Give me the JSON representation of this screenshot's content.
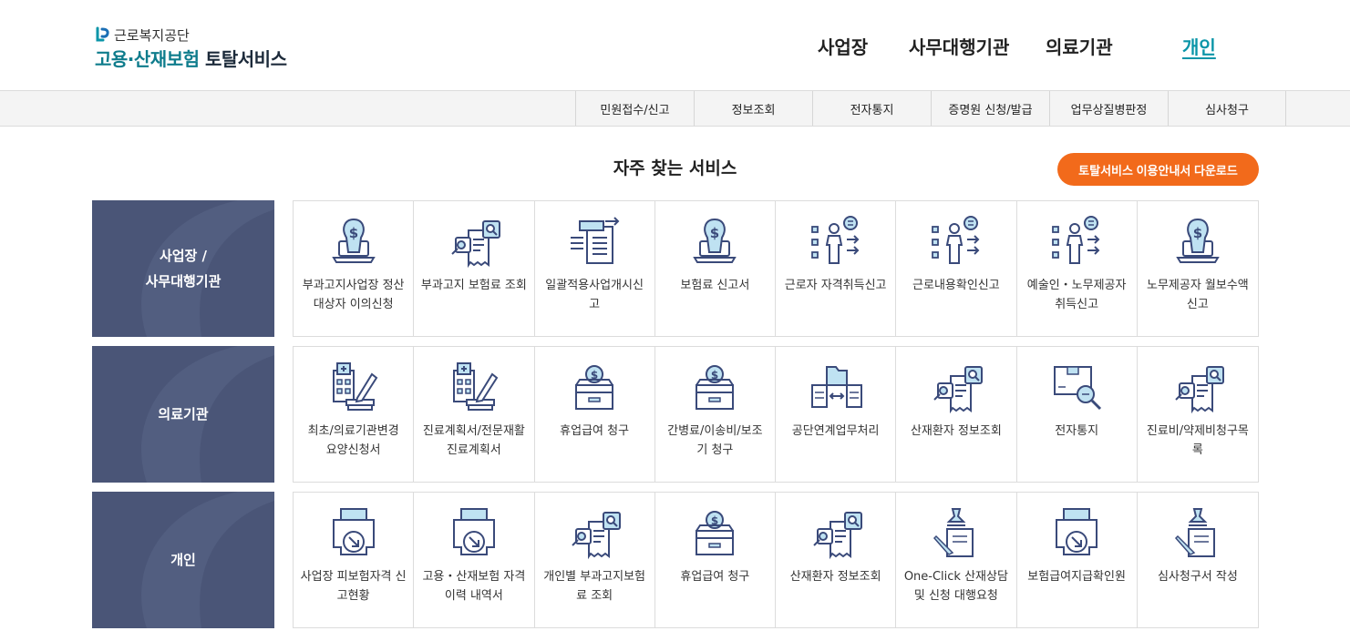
{
  "header": {
    "logo_top": "근로복지공단",
    "logo_bottom_teal": "고용·산재보험",
    "logo_bottom_dark": "토탈서비스",
    "nav": [
      {
        "label": "사업장",
        "active": false
      },
      {
        "label": "사무대행기관",
        "active": false
      },
      {
        "label": "의료기관",
        "active": false
      },
      {
        "label": "개인",
        "active": true
      }
    ]
  },
  "subnav": [
    "민원접수/신고",
    "정보조회",
    "전자통지",
    "증명원 신청/발급",
    "업무상질병판정",
    "심사청구"
  ],
  "section": {
    "title": "자주 찾는 서비스",
    "download_label": "토탈서비스 이용안내서 다운로드"
  },
  "colors": {
    "teal": "#0a95a8",
    "navy": "#3a4a7a",
    "orange": "#f26a1b",
    "label_bg": "#4a5577"
  },
  "rows": [
    {
      "label": "사업장 /\n사무대행기관",
      "items": [
        {
          "label": "부과고지사업장 정산대상자 이의신청",
          "icon": "laptop-coin-icon"
        },
        {
          "label": "부과고지 보험료 조회",
          "icon": "document-search-icon"
        },
        {
          "label": "일괄적용사업개시신고",
          "icon": "document-transfer-icon"
        },
        {
          "label": "보험료 신고서",
          "icon": "laptop-coin-icon"
        },
        {
          "label": "근로자 자격취득신고",
          "icon": "presenter-checklist-icon"
        },
        {
          "label": "근로내용확인신고",
          "icon": "presenter-checklist-icon"
        },
        {
          "label": "예술인・노무제공자 취득신고",
          "icon": "presenter-checklist-icon"
        },
        {
          "label": "노무제공자 월보수액 신고",
          "icon": "laptop-coin-icon"
        }
      ]
    },
    {
      "label": "의료기관",
      "items": [
        {
          "label": "최초/의료기관변경 요양신청서",
          "icon": "hospital-pen-icon"
        },
        {
          "label": "진료계획서/전문재활진료계획서",
          "icon": "hospital-pen-icon"
        },
        {
          "label": "휴업급여 청구",
          "icon": "coin-box-icon"
        },
        {
          "label": "간병료/이송비/보조기 청구",
          "icon": "coin-box-icon"
        },
        {
          "label": "공단연계업무처리",
          "icon": "folder-exchange-icon"
        },
        {
          "label": "산재환자 정보조회",
          "icon": "document-search-icon"
        },
        {
          "label": "전자통지",
          "icon": "package-search-icon"
        },
        {
          "label": "진료비/약제비청구목록",
          "icon": "document-search-icon"
        }
      ]
    },
    {
      "label": "개인",
      "items": [
        {
          "label": "사업장 피보험자격 신고현황",
          "icon": "printer-download-icon"
        },
        {
          "label": "고용・산재보험 자격 이력 내역서",
          "icon": "printer-download-icon"
        },
        {
          "label": "개인별 부과고지보험료 조회",
          "icon": "document-search-icon"
        },
        {
          "label": "휴업급여 청구",
          "icon": "coin-box-icon"
        },
        {
          "label": "산재환자 정보조회",
          "icon": "document-search-icon"
        },
        {
          "label": "One-Click 산재상담 및 신청 대행요청",
          "icon": "stamp-document-icon"
        },
        {
          "label": "보험급여지급확인원",
          "icon": "printer-download-icon"
        },
        {
          "label": "심사청구서 작성",
          "icon": "stamp-document-icon"
        }
      ]
    }
  ]
}
